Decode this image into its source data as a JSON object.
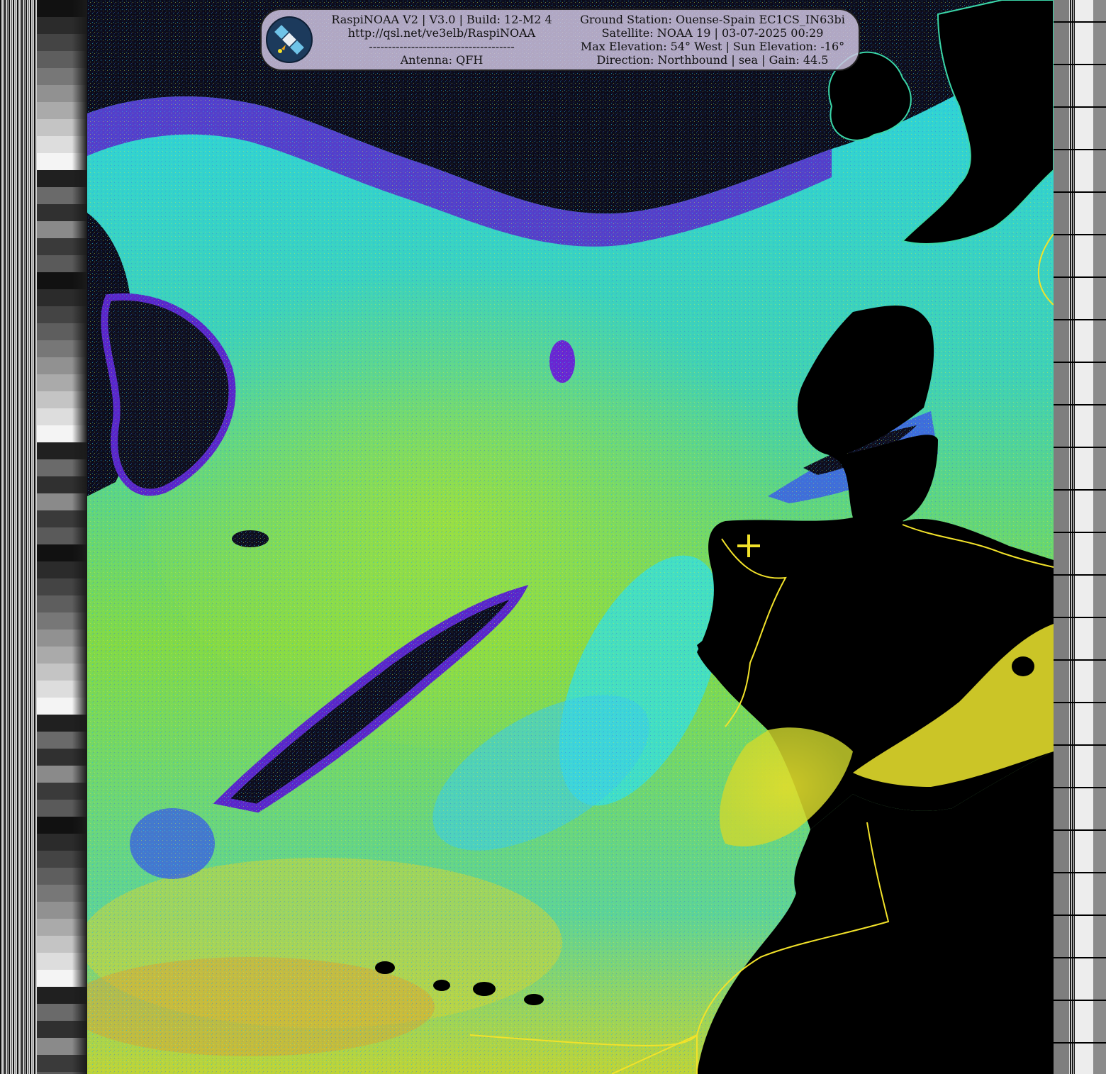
{
  "banner": {
    "left": {
      "line1": "RaspiNOAA V2 | V3.0 | Build: 12-M2 4",
      "line2": "http://qsl.net/ve3elb/RaspiNOAA",
      "line3": "--------------------------------------",
      "line4": "Antenna: QFH"
    },
    "right": {
      "line1": "Ground Station: Ouense-Spain EC1CS_IN63bi",
      "line2": "Satellite: NOAA 19 | 03-07-2025 00:29",
      "line3": "Max Elevation: 54° West | Sun Elevation: -16°",
      "line4": "Direction: Northbound | sea | Gain: 44.5"
    },
    "logo_icon": "satellite-icon"
  },
  "colors": {
    "border_line": "#f2e22a",
    "station_marker": "#f2e22a",
    "land": "#000000",
    "cloud_palette": [
      "#000000",
      "#6a1fd0",
      "#3a5ee0",
      "#27e6e6",
      "#3ad6a8",
      "#8ee33a",
      "#e0e02a",
      "#e38a1a",
      "#d62020"
    ]
  }
}
